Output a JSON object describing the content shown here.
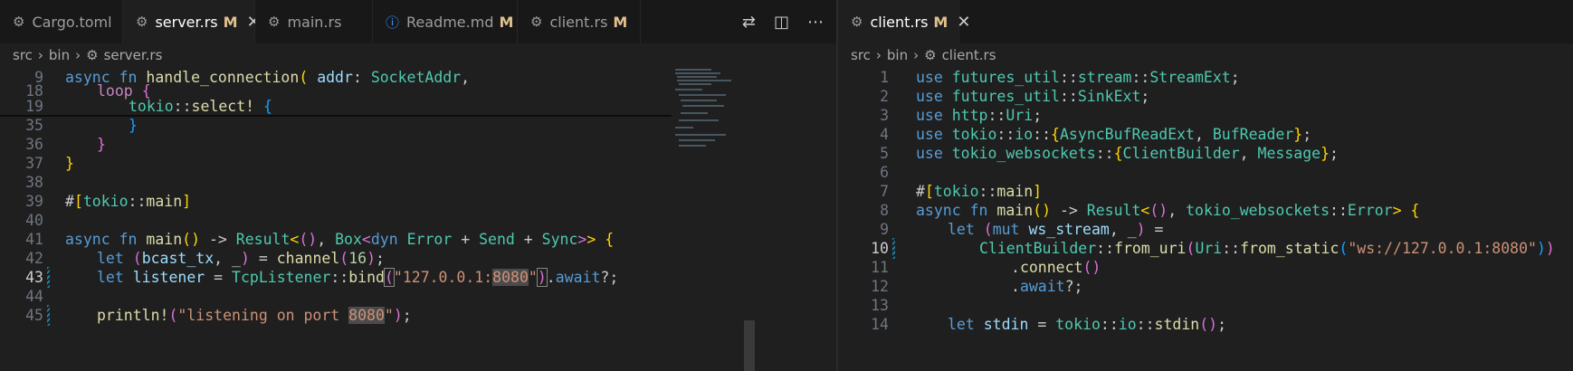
{
  "left": {
    "tabs": [
      {
        "label": "Cargo.toml",
        "icon": "gear-icon",
        "glyph": "⚙",
        "modified": "",
        "active": false
      },
      {
        "label": "server.rs",
        "icon": "rust-icon",
        "glyph": "⚙",
        "modified": "M",
        "active": true
      },
      {
        "label": "main.rs",
        "icon": "rust-icon",
        "glyph": "⚙",
        "modified": "",
        "active": false
      },
      {
        "label": "Readme.md",
        "icon": "info-icon",
        "glyph": "ⓘ",
        "modified": "M",
        "active": false
      },
      {
        "label": "client.rs",
        "icon": "rust-icon",
        "glyph": "⚙",
        "modified": "M",
        "active": false
      }
    ],
    "actions": {
      "compare": "⇄",
      "split": "◫",
      "more": "⋯"
    },
    "breadcrumb": {
      "src": "src",
      "bin": "bin",
      "file": "server.rs",
      "sep": "›"
    },
    "lines": [
      {
        "num": "9"
      },
      {
        "num": "18"
      },
      {
        "num": "19"
      },
      {
        "num": "35"
      },
      {
        "num": "36"
      },
      {
        "num": "37"
      },
      {
        "num": "38"
      },
      {
        "num": "39"
      },
      {
        "num": "40"
      },
      {
        "num": "41"
      },
      {
        "num": "42"
      },
      {
        "num": "43"
      },
      {
        "num": "44"
      },
      {
        "num": "45"
      }
    ]
  },
  "right": {
    "tab": {
      "label": "client.rs",
      "modified": "M",
      "glyph": "⚙"
    },
    "breadcrumb": {
      "src": "src",
      "bin": "bin",
      "file": "client.rs",
      "sep": "›"
    },
    "lines": [
      {
        "num": "1"
      },
      {
        "num": "2"
      },
      {
        "num": "3"
      },
      {
        "num": "4"
      },
      {
        "num": "5"
      },
      {
        "num": "6"
      },
      {
        "num": "7"
      },
      {
        "num": "8"
      },
      {
        "num": "9"
      },
      {
        "num": "10"
      },
      {
        "num": "11"
      },
      {
        "num": "12"
      },
      {
        "num": "13"
      },
      {
        "num": "14"
      }
    ]
  },
  "colors": {
    "keyword": "#569cd6",
    "control": "#c586c0",
    "function": "#dcdcaa",
    "type": "#4ec9b0",
    "string": "#ce9178"
  }
}
